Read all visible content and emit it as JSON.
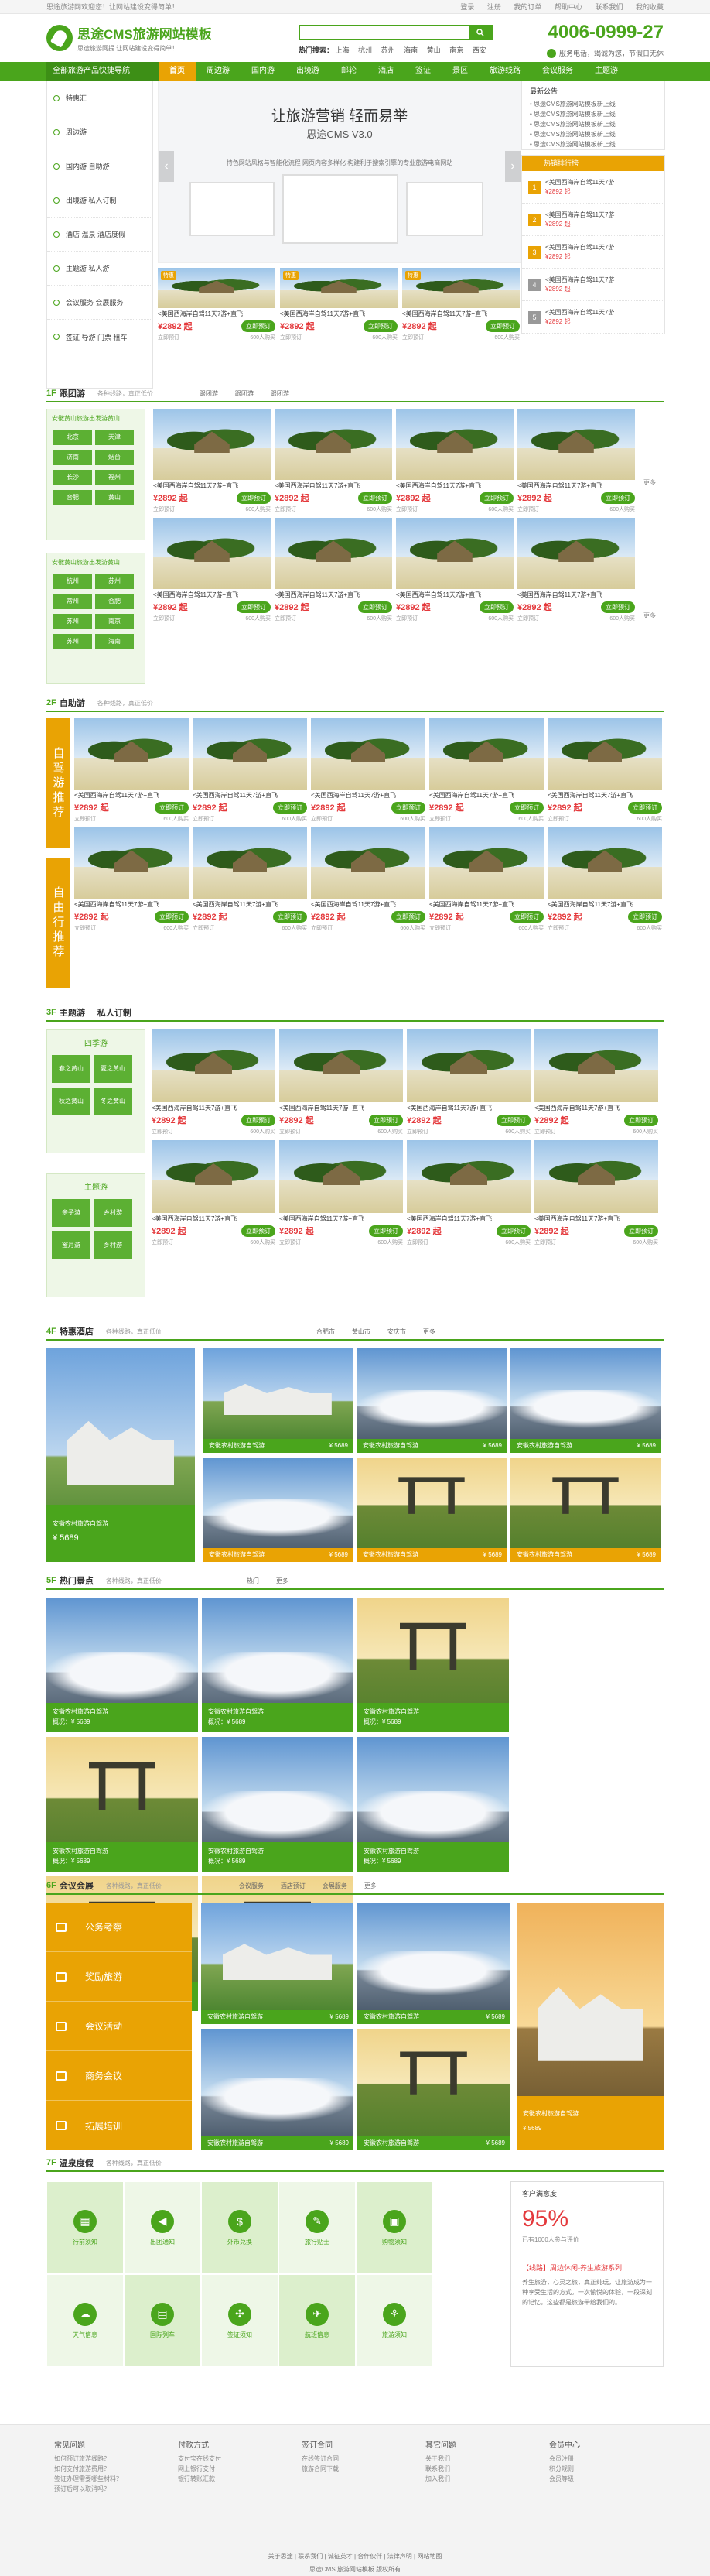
{
  "topbar": {
    "welcome": "思途旅游网欢迎您！让网站建设变得简单！",
    "links": [
      "登录",
      "注册",
      "我的订单",
      "帮助中心",
      "联系我们",
      "我的收藏"
    ]
  },
  "header": {
    "logo_title": "思途CMS旅游网站模板",
    "logo_sub": "思途旅游网提 让网站建设变得简单！",
    "search_placeholder": "",
    "hot_label": "热门搜索：",
    "hot_cities": [
      "上海",
      "杭州",
      "苏州",
      "海南",
      "黄山",
      "南京",
      "西安"
    ],
    "phone": "4006-0999-27",
    "phone_sub": "服务电话，竭诚为您，节假日无休"
  },
  "nav": {
    "category": "全部旅游产品快捷导航",
    "items": [
      "首页",
      "周边游",
      "国内游",
      "出境游",
      "邮轮",
      "酒店",
      "签证",
      "景区",
      "旅游线路",
      "会议服务",
      "主题游"
    ]
  },
  "side": [
    "特惠汇",
    "周边游",
    "国内游 自助游",
    "出境游 私人订制",
    "酒店 温泉 酒店度假",
    "主题游 私人游",
    "会议服务 会展服务",
    "签证 导游 门票 租车"
  ],
  "banner": {
    "title": "让旅游营销 轻而易举",
    "version": "思途CMS V3.0",
    "desc": "特色网站风格与智能化流程 网页内容多样化 构建利于搜索引擎的专业旅游电商网站"
  },
  "product": {
    "title": "<美国西海岸自驾11天7游+直飞",
    "price": "¥2892 起",
    "btn": "立即预订",
    "buy": "立即预订",
    "sold": "600人购买",
    "badge": "特惠"
  },
  "notice": {
    "title": "最新公告",
    "lines": [
      "• 思途CMS旅游网站模板新上线",
      "• 思途CMS旅游网站模板新上线",
      "• 思途CMS旅游网站模板新上线",
      "• 思途CMS旅游网站模板新上线",
      "• 思途CMS旅游网站模板新上线"
    ]
  },
  "hot": {
    "title": "热销排行榜",
    "items": [
      {
        "rank": "1",
        "title": "<美国西海岸自驾11天7游",
        "price": "¥2892 起"
      },
      {
        "rank": "2",
        "title": "<美国西海岸自驾11天7游",
        "price": "¥2892 起"
      },
      {
        "rank": "3",
        "title": "<美国西海岸自驾11天7游",
        "price": "¥2892 起"
      },
      {
        "rank": "4",
        "title": "<美国西海岸自驾11天7游",
        "price": "¥2892 起"
      },
      {
        "rank": "5",
        "title": "<美国西海岸自驾11天7游",
        "price": "¥2892 起"
      }
    ]
  },
  "f1": {
    "num": "1F",
    "title": "跟团游",
    "sub": "各种线路，真正低价",
    "tabs": [
      "跟团游",
      "跟团游",
      "跟团游"
    ],
    "panel1": {
      "title": "安徽黄山旅游出发游黄山",
      "chips": [
        "北京",
        "天津",
        "济南",
        "烟台",
        "长沙",
        "福州",
        "合肥",
        "黄山"
      ]
    },
    "panel2": {
      "title": "安徽黄山旅游出发游黄山",
      "chips": [
        "杭州",
        "苏州",
        "常州",
        "合肥",
        "苏州",
        "南京",
        "苏州",
        "海南"
      ]
    },
    "more": "更多"
  },
  "f2": {
    "num": "2F",
    "title": "自助游",
    "sub": "各种线路，真正低价",
    "row1": "自驾游推荐",
    "row2": "自由行推荐"
  },
  "f3": {
    "num": "3F",
    "title": "主题游",
    "sub": "各种线路，真正低价",
    "title2": "私人订制",
    "p1": {
      "title": "四季游",
      "chips": [
        "春之黄山",
        "夏之黄山",
        "秋之黄山",
        "冬之黄山"
      ]
    },
    "p2": {
      "title": "主题游",
      "chips": [
        "亲子游",
        "乡村游",
        "蜜月游",
        "乡村游"
      ]
    }
  },
  "f4": {
    "num": "4F",
    "title": "特惠酒店",
    "sub": "各种线路，真正低价",
    "tabs": [
      "合肥市",
      "黄山市",
      "安庆市",
      "更多"
    ],
    "caption": "安徽农村旅游自驾游",
    "price": "¥ 5689"
  },
  "f5": {
    "num": "5F",
    "title": "热门景点",
    "sub": "各种线路，真正低价",
    "tabs": [
      "热门",
      "更多"
    ],
    "caption": "安徽农村旅游自驾游",
    "price": "¥ 5689",
    "price_label": "概况：¥ 5689"
  },
  "f6": {
    "num": "6F",
    "title": "会议会展",
    "sub": "各种线路，真正低价",
    "tabs": [
      "会议服务",
      "酒店预订",
      "会展服务",
      "更多"
    ],
    "items": [
      "公务考察",
      "奖励旅游",
      "会议活动",
      "商务会议",
      "拓展培训"
    ],
    "caption": "安徽农村旅游自驾游",
    "price": "¥ 5689"
  },
  "f7": {
    "num": "7F",
    "title": "温泉度假",
    "sub": "各种线路，真正低价",
    "icons": [
      "行前须知",
      "出团通知",
      "外币兑换",
      "旅行贴士",
      "购物须知",
      "天气信息",
      "国际列车",
      "签证须知",
      "航班信息",
      "旅游须知"
    ],
    "survey": {
      "title": "客户满意度",
      "value": "95%",
      "note": "已有1000人参与评价",
      "card_title": "【线路】周边休闲-养生旅游系列",
      "card_body": "养生旅游，心灵之旅，真正纯玩，让旅游成为一种享受生活的方式。一次愉悦的体验，一段深刻的记忆，这些都是旅游带给我们的。"
    }
  },
  "footer": {
    "cols": [
      {
        "h": "常见问题",
        "l": [
          "如何预订旅游线路？",
          "如何支付旅游费用？",
          "签证办理需要哪些材料？",
          "预订后可以取消吗？"
        ]
      },
      {
        "h": "付款方式",
        "l": [
          "支付宝在线支付",
          "网上银行支付",
          "银行转账汇款"
        ]
      },
      {
        "h": "签订合同",
        "l": [
          "在线签订合同",
          "旅游合同下载"
        ]
      },
      {
        "h": "其它问题",
        "l": [
          "关于我们",
          "联系我们",
          "加入我们"
        ]
      },
      {
        "h": "会员中心",
        "l": [
          "会员注册",
          "积分规则",
          "会员等级"
        ]
      }
    ],
    "links": [
      "关于思途",
      "联系我们",
      "诚征英才",
      "合作伙伴",
      "法律声明",
      "网站地图"
    ],
    "copyright": "思途CMS 旅游网站模板 版权所有"
  }
}
